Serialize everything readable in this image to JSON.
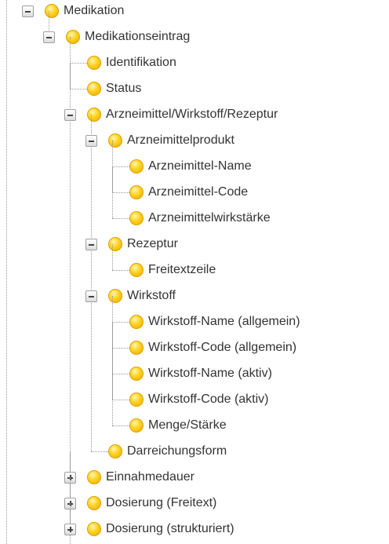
{
  "tree": {
    "nodes": [
      {
        "label": "Medikation",
        "level": 0,
        "state": "expanded"
      },
      {
        "label": "Medikationseintrag",
        "level": 1,
        "state": "expanded"
      },
      {
        "label": "Identifikation",
        "level": 2,
        "state": "leaf"
      },
      {
        "label": "Status",
        "level": 2,
        "state": "leaf"
      },
      {
        "label": "Arzneimittel/Wirkstoff/Rezeptur",
        "level": 2,
        "state": "expanded"
      },
      {
        "label": "Arzneimittelprodukt",
        "level": 3,
        "state": "expanded"
      },
      {
        "label": "Arzneimittel-Name",
        "level": 4,
        "state": "leaf"
      },
      {
        "label": "Arzneimittel-Code",
        "level": 4,
        "state": "leaf"
      },
      {
        "label": "Arzneimittelwirkstärke",
        "level": 4,
        "state": "leaf"
      },
      {
        "label": "Rezeptur",
        "level": 3,
        "state": "expanded"
      },
      {
        "label": "Freitextzeile",
        "level": 4,
        "state": "leaf"
      },
      {
        "label": "Wirkstoff",
        "level": 3,
        "state": "expanded"
      },
      {
        "label": "Wirkstoff-Name (allgemein)",
        "level": 4,
        "state": "leaf"
      },
      {
        "label": "Wirkstoff-Code (allgemein)",
        "level": 4,
        "state": "leaf"
      },
      {
        "label": "Wirkstoff-Name (aktiv)",
        "level": 4,
        "state": "leaf"
      },
      {
        "label": "Wirkstoff-Code (aktiv)",
        "level": 4,
        "state": "leaf"
      },
      {
        "label": "Menge/Stärke",
        "level": 4,
        "state": "leaf"
      },
      {
        "label": "Darreichungsform",
        "level": 3,
        "state": "leaf"
      },
      {
        "label": "Einnahmedauer",
        "level": 2,
        "state": "collapsed"
      },
      {
        "label": "Dosierung (Freitext)",
        "level": 2,
        "state": "collapsed"
      },
      {
        "label": "Dosierung (strukturiert)",
        "level": 2,
        "state": "collapsed"
      }
    ]
  },
  "colors": {
    "text": "#333333",
    "connector": "#9a9a9a",
    "node_icon": "#ffd21e"
  }
}
